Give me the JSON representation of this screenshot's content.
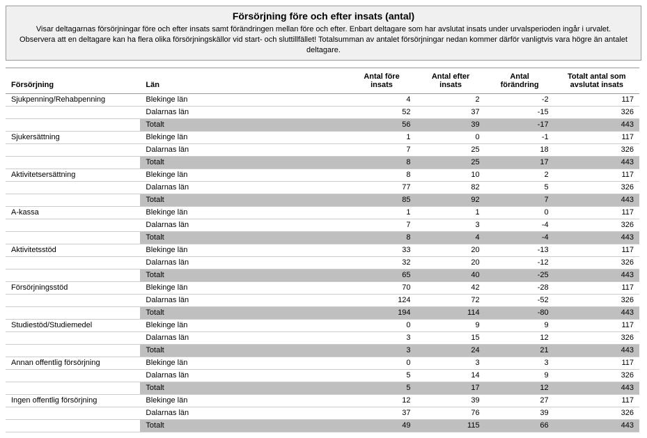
{
  "header": {
    "title": "Försörjning före och efter insats (antal)",
    "line1": "Visar deltagarnas försörjningar före och efter insats samt förändringen mellan före och efter. Enbart deltagare som har avslutat insats under urvalsperioden ingår i urvalet.",
    "line2": "Observera att en deltagare kan ha flera olika försörjningskällor vid start- och sluttillfället! Totalsumman av antalet försörjningar nedan kommer därför vanligtvis vara högre än antalet deltagare."
  },
  "columns": {
    "category": "Försörjning",
    "lan": "Län",
    "before": "Antal före insats",
    "after": "Antal efter insats",
    "change": "Antal förändring",
    "total_finished": "Totalt antal som avslutat insats"
  },
  "total_label": "Totalt",
  "lan_blekinge": "Blekinge län",
  "lan_dalarna": "Dalarnas län",
  "chart_data": {
    "type": "table",
    "categories": [
      {
        "name": "Sjukpenning/Rehabpenning",
        "rows": [
          {
            "lan": "Blekinge län",
            "before": 4,
            "after": 2,
            "change": -2,
            "total": 117
          },
          {
            "lan": "Dalarnas län",
            "before": 52,
            "after": 37,
            "change": -15,
            "total": 326
          }
        ],
        "totals": {
          "before": 56,
          "after": 39,
          "change": -17,
          "total": 443
        }
      },
      {
        "name": "Sjukersättning",
        "rows": [
          {
            "lan": "Blekinge län",
            "before": 1,
            "after": 0,
            "change": -1,
            "total": 117
          },
          {
            "lan": "Dalarnas län",
            "before": 7,
            "after": 25,
            "change": 18,
            "total": 326
          }
        ],
        "totals": {
          "before": 8,
          "after": 25,
          "change": 17,
          "total": 443
        }
      },
      {
        "name": "Aktivitetsersättning",
        "rows": [
          {
            "lan": "Blekinge län",
            "before": 8,
            "after": 10,
            "change": 2,
            "total": 117
          },
          {
            "lan": "Dalarnas län",
            "before": 77,
            "after": 82,
            "change": 5,
            "total": 326
          }
        ],
        "totals": {
          "before": 85,
          "after": 92,
          "change": 7,
          "total": 443
        }
      },
      {
        "name": "A-kassa",
        "rows": [
          {
            "lan": "Blekinge län",
            "before": 1,
            "after": 1,
            "change": 0,
            "total": 117
          },
          {
            "lan": "Dalarnas län",
            "before": 7,
            "after": 3,
            "change": -4,
            "total": 326
          }
        ],
        "totals": {
          "before": 8,
          "after": 4,
          "change": -4,
          "total": 443
        }
      },
      {
        "name": "Aktivitetsstöd",
        "rows": [
          {
            "lan": "Blekinge län",
            "before": 33,
            "after": 20,
            "change": -13,
            "total": 117
          },
          {
            "lan": "Dalarnas län",
            "before": 32,
            "after": 20,
            "change": -12,
            "total": 326
          }
        ],
        "totals": {
          "before": 65,
          "after": 40,
          "change": -25,
          "total": 443
        }
      },
      {
        "name": "Försörjningsstöd",
        "rows": [
          {
            "lan": "Blekinge län",
            "before": 70,
            "after": 42,
            "change": -28,
            "total": 117
          },
          {
            "lan": "Dalarnas län",
            "before": 124,
            "after": 72,
            "change": -52,
            "total": 326
          }
        ],
        "totals": {
          "before": 194,
          "after": 114,
          "change": -80,
          "total": 443
        }
      },
      {
        "name": "Studiestöd/Studiemedel",
        "rows": [
          {
            "lan": "Blekinge län",
            "before": 0,
            "after": 9,
            "change": 9,
            "total": 117
          },
          {
            "lan": "Dalarnas län",
            "before": 3,
            "after": 15,
            "change": 12,
            "total": 326
          }
        ],
        "totals": {
          "before": 3,
          "after": 24,
          "change": 21,
          "total": 443
        }
      },
      {
        "name": "Annan offentlig försörjning",
        "rows": [
          {
            "lan": "Blekinge län",
            "before": 0,
            "after": 3,
            "change": 3,
            "total": 117
          },
          {
            "lan": "Dalarnas län",
            "before": 5,
            "after": 14,
            "change": 9,
            "total": 326
          }
        ],
        "totals": {
          "before": 5,
          "after": 17,
          "change": 12,
          "total": 443
        }
      },
      {
        "name": "Ingen offentlig försörjning",
        "rows": [
          {
            "lan": "Blekinge län",
            "before": 12,
            "after": 39,
            "change": 27,
            "total": 117
          },
          {
            "lan": "Dalarnas län",
            "before": 37,
            "after": 76,
            "change": 39,
            "total": 326
          }
        ],
        "totals": {
          "before": 49,
          "after": 115,
          "change": 66,
          "total": 443
        }
      }
    ]
  }
}
